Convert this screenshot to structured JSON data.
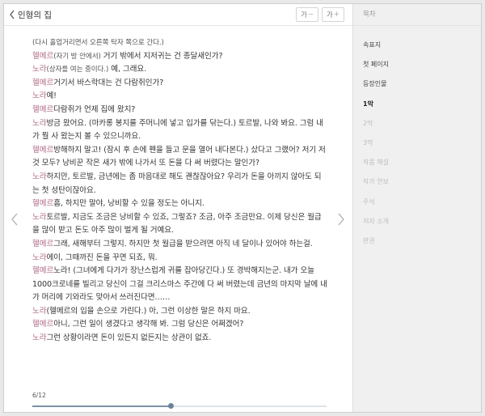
{
  "header": {
    "title": "인형의 집",
    "font_decrease_label": "가",
    "font_increase_label": "가"
  },
  "toc": {
    "heading": "목차",
    "items": [
      {
        "label": "속표지",
        "state": "normal"
      },
      {
        "label": "첫 페이지",
        "state": "normal"
      },
      {
        "label": "등장인물",
        "state": "normal"
      },
      {
        "label": "1막",
        "state": "active"
      },
      {
        "label": "2막",
        "state": "disabled"
      },
      {
        "label": "3막",
        "state": "disabled"
      },
      {
        "label": "작품 해설",
        "state": "disabled"
      },
      {
        "label": "작가 연보",
        "state": "disabled"
      },
      {
        "label": "주석",
        "state": "disabled"
      },
      {
        "label": "저자 소개",
        "state": "disabled"
      },
      {
        "label": "판권",
        "state": "disabled"
      }
    ]
  },
  "content": {
    "lines": [
      {
        "speaker": "",
        "direction": "(다시 홀업거리면서 오른쪽 탁자 쪽으로 간다.)",
        "text": ""
      },
      {
        "speaker": "헬메르",
        "direction": "(자기 방 안에서)",
        "text": " 거기 밖에서 지저귀는 건 종달새인가?"
      },
      {
        "speaker": "노라",
        "direction": "(상자를 여는 중이다.)",
        "text": " 예, 그래요."
      },
      {
        "speaker": "헬메르",
        "direction": "",
        "text": "거기서 바스락대는 건 다람쥐인가?"
      },
      {
        "speaker": "노라",
        "direction": "",
        "text": "예!"
      },
      {
        "speaker": "헬메르",
        "direction": "",
        "text": "다람쥐가 언제 집에 왔지?"
      },
      {
        "speaker": "노라",
        "direction": "",
        "text": "방금 왔어요. (마카롱 봉지를 주머니에 넣고 입가를 닦는다.) 토르발, 나와 봐요. 그럼 내가 뭘 사 왔는지 볼 수 있으니까요."
      },
      {
        "speaker": "헬메르",
        "direction": "",
        "text": "방해하지 말고! (잠시 후 손에 펜을 들고 문을 열어 내다본다.) 샀다고 그랬어? 저기 저것 모두? 낭비꾼 작은 새가 밖에 나가서 또 돈을 다 써 버렸다는 말인가?"
      },
      {
        "speaker": "노라",
        "direction": "",
        "text": "하지만, 토르발, 금년에는 좀 마음대로 해도 괜찮잖아요? 우리가 돈을 아끼지 않아도 되는 첫 성탄이잖아요."
      },
      {
        "speaker": "헬메르",
        "direction": "",
        "text": "흠, 하지만 말야, 낭비할 수 있을 정도는 아니지."
      },
      {
        "speaker": "노라",
        "direction": "",
        "text": "토르발, 지금도 조금은 낭비할 수 있죠, 그렇죠? 조금, 아주 조금만요. 이제 당신은 월급을 많이 받고 돈도 아주 많이 벌게 될 거예요."
      },
      {
        "speaker": "헬메르",
        "direction": "",
        "text": "그래, 새해부터 그렇지. 하지만 첫 월급을 받으려면 아직 네 달이나 있어야 하는걸."
      },
      {
        "speaker": "노라",
        "direction": "",
        "text": "에이, 그때까진 돈을 꾸면 되죠, 뭐."
      },
      {
        "speaker": "헬메르",
        "direction": "",
        "text": "노라! (그녀에게 다가가 장난스럽게 귀를 잡아당긴다.) 또 경박해지는군. 내가 오늘 1000크로네를 빌리고 당신이 그걸 크리스마스 주간에 다 써 버렸는데 금년의 마지막 날에 내가 머리에 기와라도 맞아서 쓰러진다면……"
      },
      {
        "speaker": "노라",
        "direction": "",
        "text": "(헬메르의 입을 손으로 가린다.) 아, 그런 이상한 말은 하지 마요."
      },
      {
        "speaker": "헬메르",
        "direction": "",
        "text": "아니, 그런 일이 생겼다고 생각해 봐. 그럼 당신은 어쩌겠어?"
      },
      {
        "speaker": "노라",
        "direction": "",
        "text": "그런 상황이라면 돈이 있든지 없든지는 상관이 없죠."
      }
    ]
  },
  "progress": {
    "label": "6/12",
    "current": 6,
    "total": 12,
    "fraction": 0.47
  },
  "colors": {
    "speaker": "#b06a86",
    "progress_fill": "#7d92a8",
    "sidebar_bg": "#f0f0f0"
  },
  "icons": {
    "back": "chevron-left-icon",
    "prev_page": "chevron-left-icon",
    "next_page": "chevron-right-icon"
  }
}
